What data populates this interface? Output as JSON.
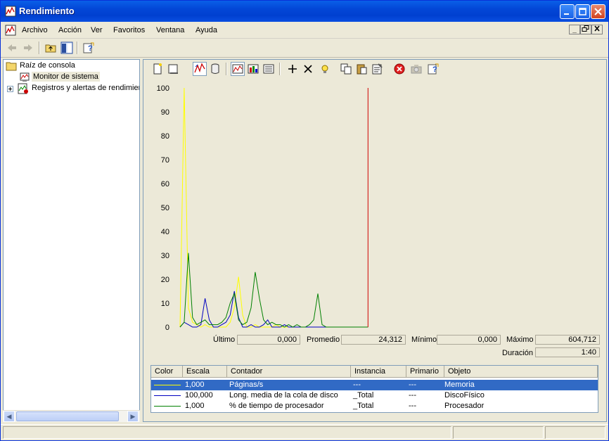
{
  "window": {
    "title": "Rendimiento"
  },
  "menu": {
    "items": [
      "Archivo",
      "Acción",
      "Ver",
      "Favoritos",
      "Ventana",
      "Ayuda"
    ]
  },
  "tree": {
    "root": "Raíz de consola",
    "monitor": "Monitor de sistema",
    "logs": "Registros y alertas de rendimien"
  },
  "chart_data": {
    "type": "line",
    "ylim": [
      0,
      100
    ],
    "yticks": [
      "100",
      "90",
      "80",
      "70",
      "60",
      "50",
      "40",
      "30",
      "20",
      "10",
      "0"
    ],
    "samples": 100,
    "current_index": 45,
    "series": [
      {
        "name": "Páginas/s",
        "color": "#ffff00",
        "values": [
          0,
          100,
          8,
          2,
          1,
          0,
          1,
          0,
          0,
          0,
          0,
          0,
          2,
          8,
          21,
          5,
          0,
          0,
          1,
          0,
          0,
          0,
          0,
          1,
          0,
          0,
          0,
          0,
          0,
          0,
          0,
          0,
          0,
          0,
          0,
          0,
          0,
          0,
          0,
          0,
          0,
          0,
          0,
          0,
          0,
          0
        ]
      },
      {
        "name": "Long. media de la cola de disco",
        "color": "#0000c0",
        "values": [
          0,
          2,
          1,
          0,
          0,
          1,
          12,
          3,
          0,
          0,
          1,
          2,
          5,
          15,
          4,
          0,
          0,
          1,
          0,
          0,
          1,
          3,
          0,
          0,
          0,
          1,
          0,
          0,
          0,
          0,
          0,
          0,
          0,
          0,
          0,
          0,
          0,
          0,
          0,
          0,
          0,
          0,
          0,
          0,
          0,
          0
        ]
      },
      {
        "name": "% de tiempo de procesador",
        "color": "#008000",
        "values": [
          0,
          2,
          31,
          4,
          1,
          2,
          3,
          1,
          1,
          1,
          2,
          4,
          10,
          14,
          3,
          1,
          2,
          8,
          23,
          12,
          3,
          1,
          2,
          1,
          1,
          0,
          1,
          0,
          1,
          0,
          0,
          1,
          3,
          14,
          1,
          0,
          0,
          0,
          0,
          0,
          0,
          0,
          0,
          0,
          0,
          0
        ]
      }
    ]
  },
  "stats": {
    "ultimo_label": "Último",
    "ultimo": "0,000",
    "promedio_label": "Promedio",
    "promedio": "24,312",
    "minimo_label": "Mínimo",
    "minimo": "0,000",
    "maximo_label": "Máximo",
    "maximo": "604,712",
    "duracion_label": "Duración",
    "duracion": "1:40"
  },
  "counters": {
    "headers": [
      "Color",
      "Escala",
      "Contador",
      "Instancia",
      "Primario",
      "Objeto"
    ],
    "rows": [
      {
        "color": "#ffff00",
        "escala": "1,000",
        "contador": "Páginas/s",
        "instancia": "---",
        "primario": "---",
        "objeto": "Memoria"
      },
      {
        "color": "#0000c0",
        "escala": "100,000",
        "contador": "Long. media de la cola de disco",
        "instancia": "_Total",
        "primario": "---",
        "objeto": "DiscoFísico"
      },
      {
        "color": "#008000",
        "escala": "1,000",
        "contador": "% de tiempo de procesador",
        "instancia": "_Total",
        "primario": "---",
        "objeto": "Procesador"
      }
    ]
  }
}
